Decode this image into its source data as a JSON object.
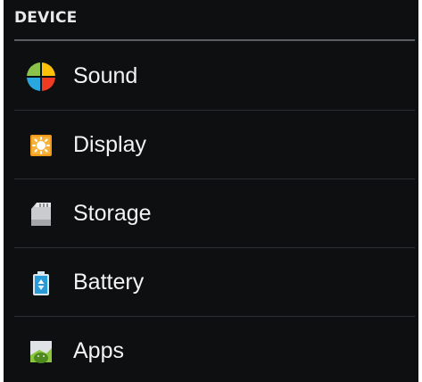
{
  "section": {
    "title": "DEVICE"
  },
  "items": [
    {
      "label": "Sound",
      "icon": "sound-icon"
    },
    {
      "label": "Display",
      "icon": "display-icon"
    },
    {
      "label": "Storage",
      "icon": "storage-icon"
    },
    {
      "label": "Battery",
      "icon": "battery-icon"
    },
    {
      "label": "Apps",
      "icon": "apps-icon"
    }
  ],
  "colors": {
    "background": "#0d0f11",
    "header_text": "#e7e9eb",
    "divider": "#5b5e61",
    "row_divider": "#2c2f32",
    "item_text": "#f2f3f4"
  }
}
